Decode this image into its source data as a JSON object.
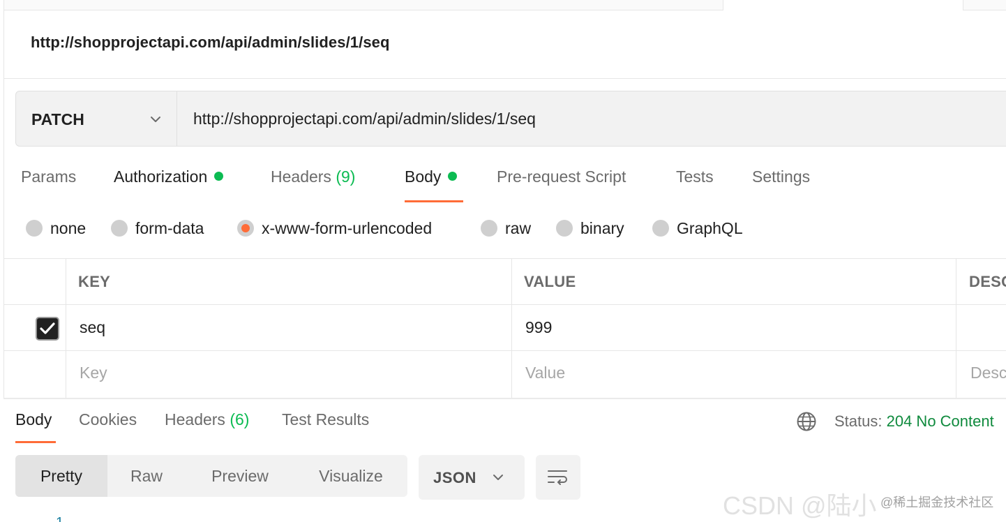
{
  "request": {
    "title": "http://shopprojectapi.com/api/admin/slides/1/seq",
    "method": "PATCH",
    "url": "http://shopprojectapi.com/api/admin/slides/1/seq"
  },
  "request_tabs": {
    "params": "Params",
    "authorization": "Authorization",
    "headers": "Headers",
    "headers_count": "(9)",
    "body": "Body",
    "prerequest": "Pre-request Script",
    "tests": "Tests",
    "settings": "Settings",
    "active": "Body"
  },
  "body_types": {
    "none": "none",
    "form_data": "form-data",
    "urlencoded": "x-www-form-urlencoded",
    "raw": "raw",
    "binary": "binary",
    "graphql": "GraphQL",
    "selected": "x-www-form-urlencoded"
  },
  "params_table": {
    "headers": {
      "key": "KEY",
      "value": "VALUE",
      "description": "DESC"
    },
    "rows": [
      {
        "checked": true,
        "key": "seq",
        "value": "999"
      }
    ],
    "placeholders": {
      "key": "Key",
      "value": "Value",
      "description": "Desc"
    }
  },
  "response_tabs": {
    "body": "Body",
    "cookies": "Cookies",
    "headers": "Headers",
    "headers_count": "(6)",
    "test_results": "Test Results",
    "active": "Body"
  },
  "response_status": {
    "label": "Status:",
    "value": "204 No Content"
  },
  "response_view": {
    "pretty": "Pretty",
    "raw": "Raw",
    "preview": "Preview",
    "visualize": "Visualize",
    "active": "Pretty",
    "format": "JSON"
  },
  "editor": {
    "first_line_number": "1"
  },
  "watermark": {
    "large": "CSDN @陆小",
    "small": "@稀土掘金技术社区"
  },
  "colors": {
    "accent": "#ff6c37",
    "status_green": "#0cbb52",
    "status_ok_text": "#0f8a3d"
  },
  "icons": [
    "chevron-down-icon",
    "globe-icon",
    "wrap-lines-icon",
    "checkmark-icon"
  ]
}
